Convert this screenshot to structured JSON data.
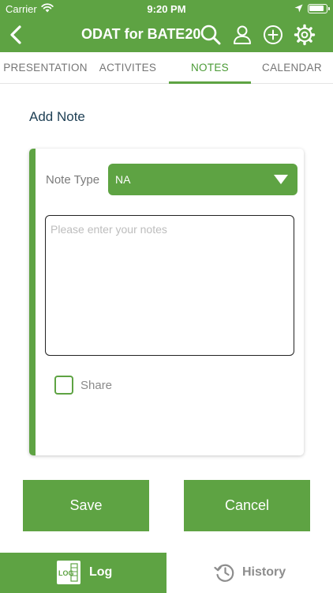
{
  "status_bar": {
    "carrier": "Carrier",
    "time": "9:20 PM"
  },
  "nav": {
    "title": "ODAT for BATE20"
  },
  "tabs": [
    {
      "label": "PRESENTATION",
      "active": false
    },
    {
      "label": "ACTIVITES",
      "active": false
    },
    {
      "label": "NOTES",
      "active": true
    },
    {
      "label": "CALENDAR",
      "active": false
    }
  ],
  "form": {
    "section_title": "Add Note",
    "note_type_label": "Note Type",
    "note_type_value": "NA",
    "notes_value": "",
    "notes_placeholder": "Please enter your notes",
    "share_label": "Share",
    "share_checked": false
  },
  "actions": {
    "save_label": "Save",
    "cancel_label": "Cancel"
  },
  "bottom_tabs": {
    "log_label": "Log",
    "history_label": "History",
    "log_icon_text": "LOG"
  },
  "colors": {
    "brand_green": "#5ea343",
    "title_text": "#1f4055",
    "muted_text": "#7a7a7a"
  },
  "icons": [
    "back-icon",
    "search-icon",
    "user-icon",
    "add-icon",
    "gear-icon",
    "dropdown-icon",
    "log-icon",
    "history-icon",
    "wifi-icon",
    "location-icon",
    "battery-icon"
  ]
}
